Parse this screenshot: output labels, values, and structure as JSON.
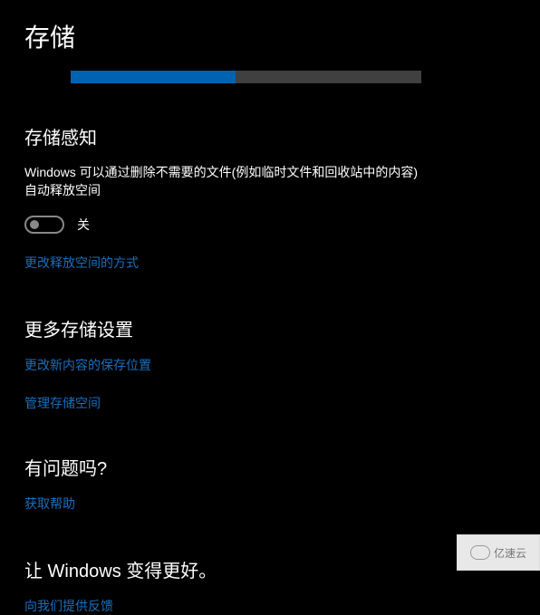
{
  "page": {
    "title": "存储"
  },
  "storage_bar": {
    "used_percent": 47
  },
  "storage_sense": {
    "heading": "存储感知",
    "description": "Windows 可以通过删除不需要的文件(例如临时文件和回收站中的内容)自动释放空间",
    "toggle_state": "关",
    "change_link": "更改释放空间的方式"
  },
  "more_settings": {
    "heading": "更多存储设置",
    "change_save_location": "更改新内容的保存位置",
    "manage_storage": "管理存储空间"
  },
  "help": {
    "heading": "有问题吗?",
    "get_help": "获取帮助"
  },
  "feedback": {
    "heading": "让 Windows 变得更好。",
    "give_feedback": "向我们提供反馈"
  },
  "watermark": {
    "text": "亿速云"
  }
}
